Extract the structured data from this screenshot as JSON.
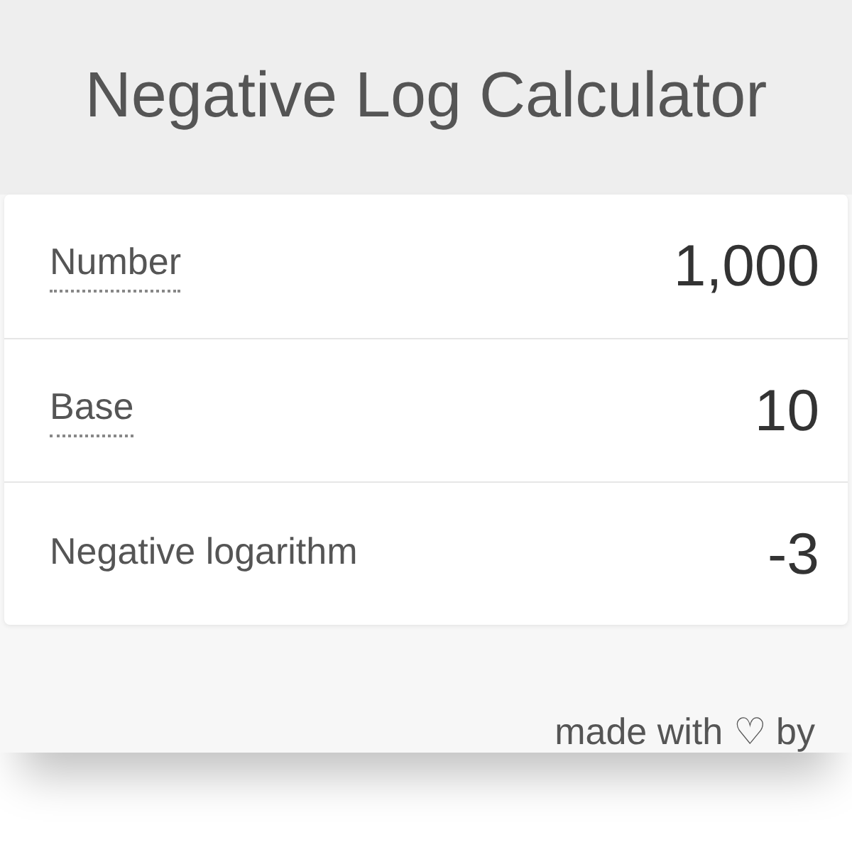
{
  "title": "Negative Log Calculator",
  "rows": [
    {
      "kind": "input",
      "label": "Number",
      "value": "1,000"
    },
    {
      "kind": "input",
      "label": "Base",
      "value": "10"
    },
    {
      "kind": "result",
      "label": "Negative logarithm",
      "value": "-3"
    }
  ],
  "footer": {
    "text": "made with ♡ by"
  }
}
